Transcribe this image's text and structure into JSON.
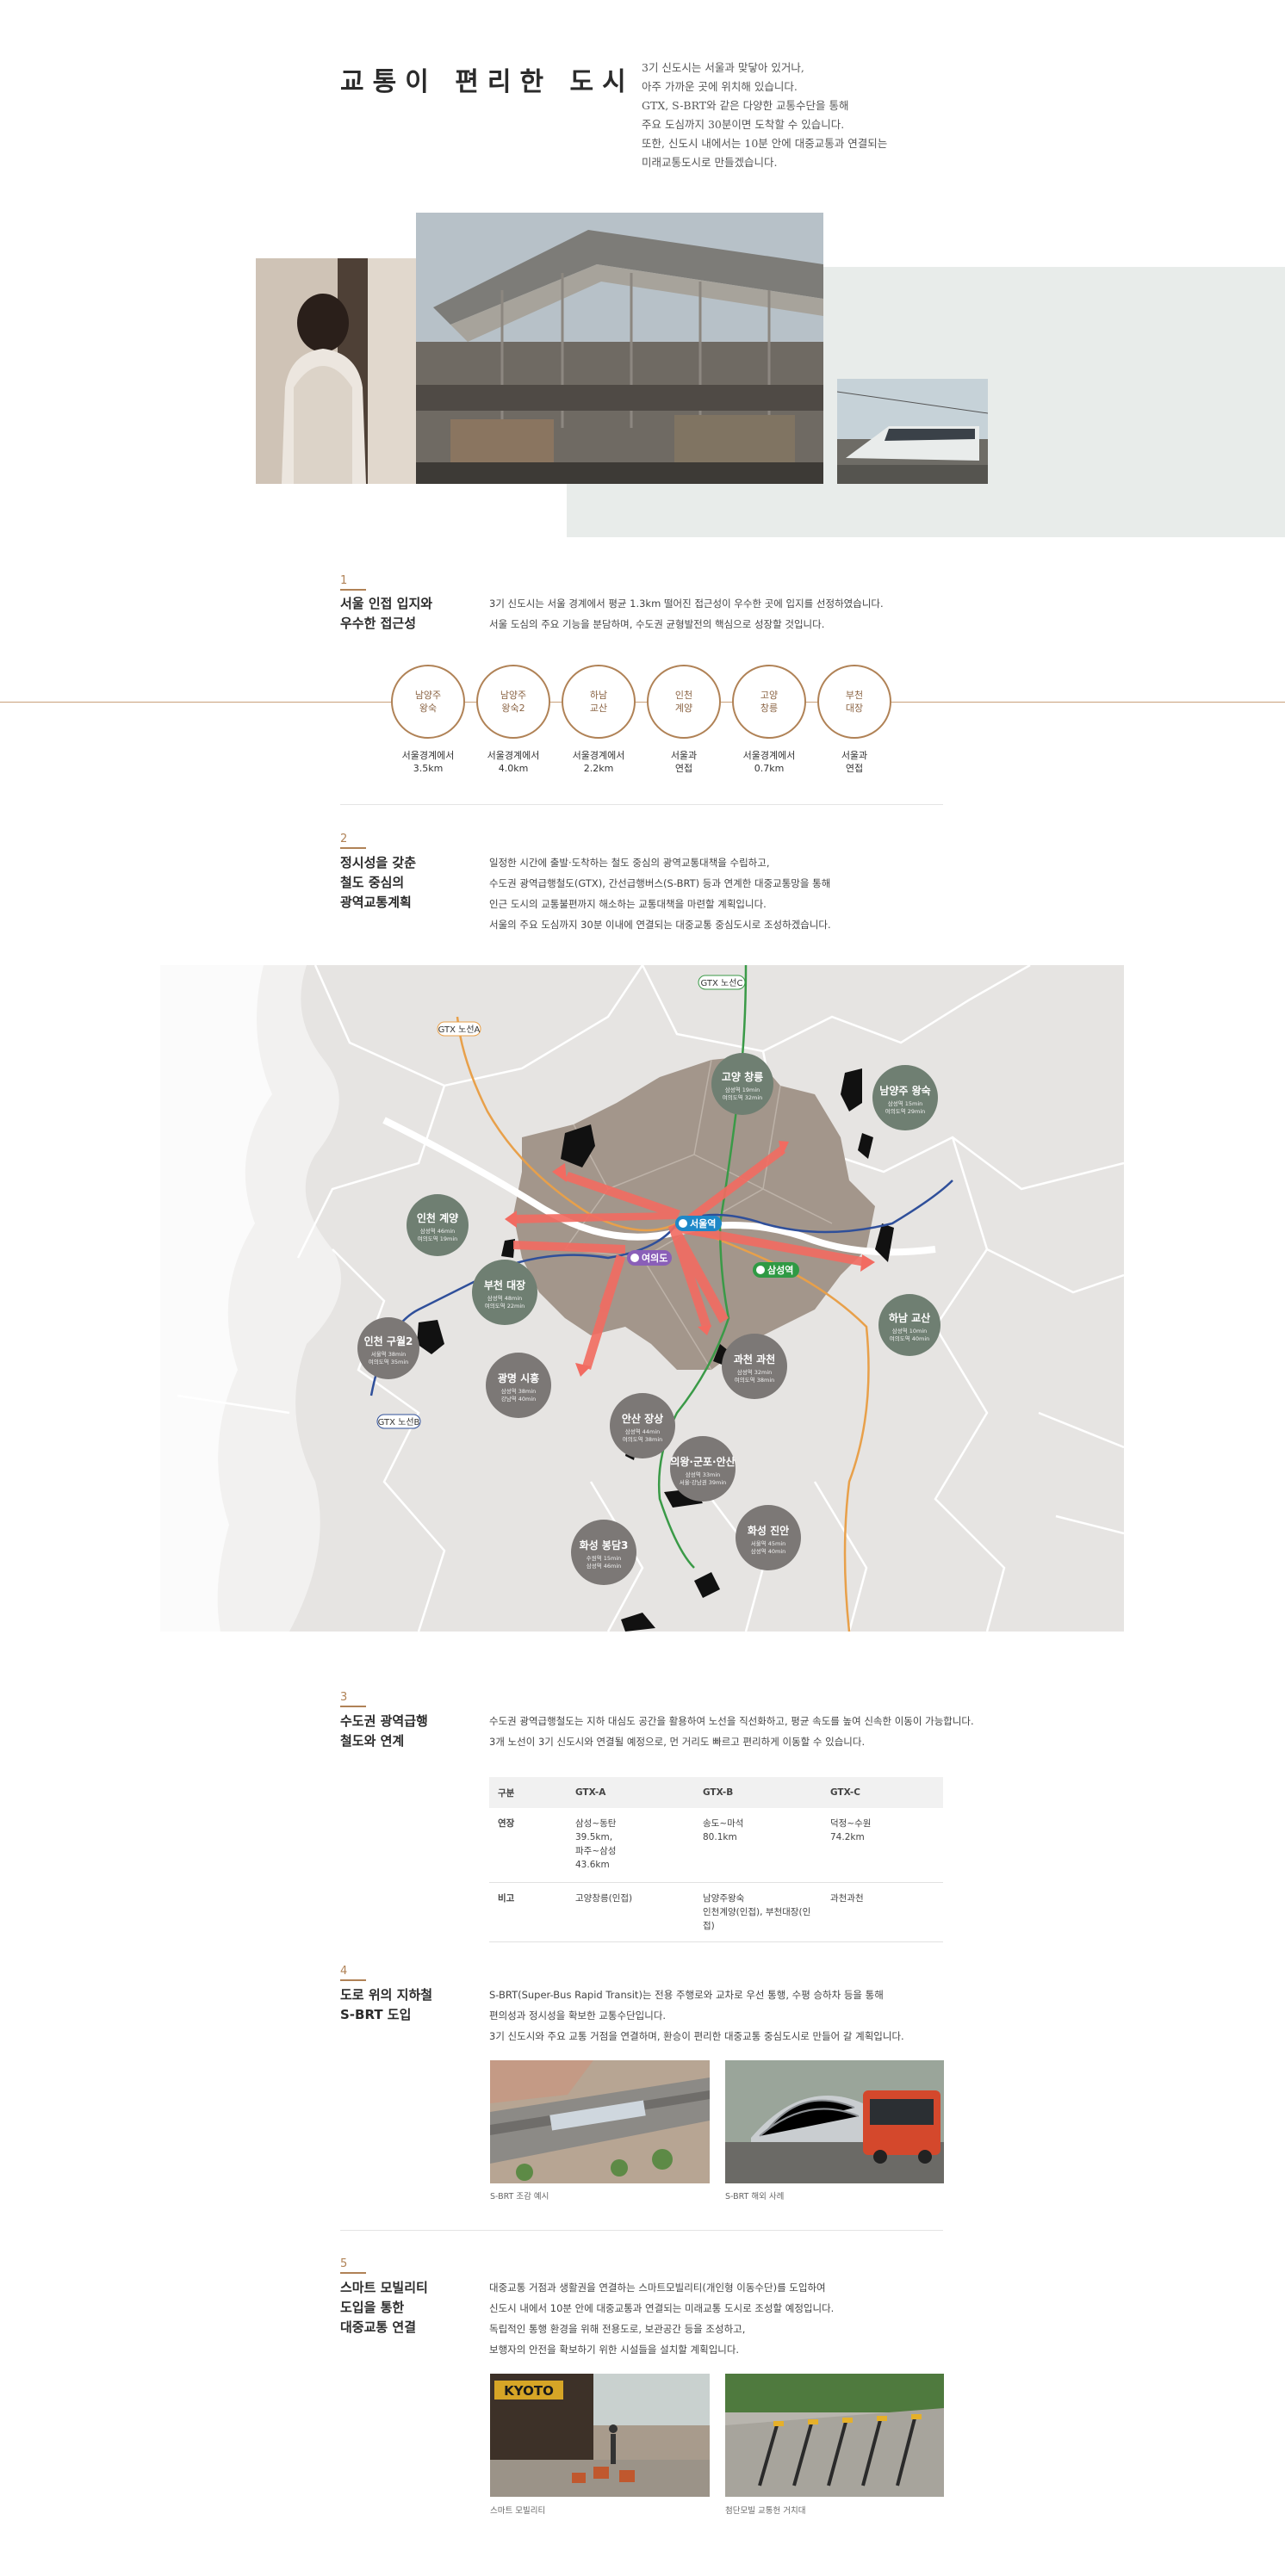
{
  "header": {
    "title": "교통이 편리한 도시",
    "desc": [
      "3기 신도시는 서울과 맞닿아 있거나,",
      "아주 가까운 곳에 위치해 있습니다.",
      "GTX, S-BRT와 같은 다양한 교통수단을 통해",
      "주요 도심까지 30분이면 도착할 수 있습니다.",
      "또한, 신도시 내에서는 10분 안에 대중교통과 연결되는",
      "미래교통도시로 만들겠습니다."
    ]
  },
  "s1": {
    "num": "1",
    "title": [
      "서울 인접 입지와",
      "우수한 접근성"
    ],
    "body": [
      "3기 신도시는 서울 경계에서 평균 1.3km 떨어진 접근성이 우수한 곳에 입지를 선정하였습니다.",
      "서울 도심의 주요 기능을 분담하며, 수도권 균형발전의 핵심으로 성장할 것입니다."
    ],
    "circles": [
      {
        "name": [
          "남양주",
          "왕숙"
        ],
        "cap": [
          "서울경계에서",
          "3.5km"
        ]
      },
      {
        "name": [
          "남양주",
          "왕숙2"
        ],
        "cap": [
          "서울경계에서",
          "4.0km"
        ]
      },
      {
        "name": [
          "하남",
          "교산"
        ],
        "cap": [
          "서울경계에서",
          "2.2km"
        ]
      },
      {
        "name": [
          "인천",
          "계양"
        ],
        "cap": [
          "서울과",
          "연접"
        ]
      },
      {
        "name": [
          "고양",
          "창릉"
        ],
        "cap": [
          "서울경계에서",
          "0.7km"
        ]
      },
      {
        "name": [
          "부천",
          "대장"
        ],
        "cap": [
          "서울과",
          "연접"
        ]
      }
    ]
  },
  "s2": {
    "num": "2",
    "title": [
      "정시성을 갖춘",
      "철도 중심의",
      "광역교통계획"
    ],
    "body": [
      "일정한 시간에 출발·도착하는 철도 중심의 광역교통대책을 수립하고,",
      "수도권 광역급행철도(GTX), 간선급행버스(S-BRT) 등과 연계한 대중교통망을 통해",
      "인근 도시의 교통불편까지 해소하는 교통대책을 마련할 계획입니다.",
      "서울의 주요 도심까지 30분 이내에 연결되는 대중교통 중심도시로 조성하겠습니다."
    ]
  },
  "map": {
    "lines": [
      {
        "label": "GTX 노선A",
        "color": "#e8a04a"
      },
      {
        "label": "GTX 노선C",
        "color": "#3a9a47"
      },
      {
        "label": "GTX 노선B",
        "color": "#2f4f9a"
      }
    ],
    "stations": [
      "서울역",
      "여의도",
      "삼성역"
    ],
    "cities": [
      {
        "name": "고양 창릉",
        "info": [
          "삼성역 19min",
          "여의도역 32min"
        ]
      },
      {
        "name": "남양주 왕숙",
        "info": [
          "삼성역 15min",
          "여의도역 29min"
        ]
      },
      {
        "name": "인천 계양",
        "info": [
          "삼성역 46min",
          "여의도역 19min"
        ]
      },
      {
        "name": "부천 대장",
        "info": [
          "삼성역 48min",
          "여의도역 22min"
        ]
      },
      {
        "name": "인천 구월2",
        "info": [
          "서울역 38min",
          "여의도역 35min"
        ]
      },
      {
        "name": "광명 시흥",
        "info": [
          "삼성역 38min",
          "강남역 40min"
        ]
      },
      {
        "name": "하남 교산",
        "info": [
          "삼성역 10min",
          "여의도역 40min"
        ]
      },
      {
        "name": "과천 과천",
        "info": [
          "삼성역 32min",
          "여의도역 38min"
        ]
      },
      {
        "name": "안산 장상",
        "info": [
          "삼성역 44min",
          "여의도역 38min"
        ]
      },
      {
        "name": "의왕·군포·안산",
        "info": [
          "삼성역 33min",
          "서울·강남권 39min"
        ]
      },
      {
        "name": "화성 진안",
        "info": [
          "서울역 45min",
          "삼성역 40min"
        ]
      },
      {
        "name": "화성 봉담3",
        "info": [
          "수원역 15min",
          "삼성역 46min"
        ]
      }
    ],
    "colors": {
      "seoul": "#a3968b",
      "badge": "#6f7f72",
      "badge_grey": "#7c7876",
      "arrow": "#f26b61",
      "land": "#e6e4e2"
    }
  },
  "s3": {
    "num": "3",
    "title": [
      "수도권 광역급행",
      "철도와 연계"
    ],
    "body": [
      "수도권 광역급행철도는 지하 대심도 공간을 활용하여 노선을 직선화하고, 평균 속도를 높여 신속한 이동이 가능합니다.",
      "3개 노선이 3기 신도시와 연결될 예정으로, 먼 거리도 빠르고 편리하게 이동할 수 있습니다."
    ],
    "table": {
      "headers": [
        "구분",
        "GTX-A",
        "GTX-B",
        "GTX-C"
      ],
      "rows": [
        {
          "label": "연장",
          "cells": [
            [
              "삼성~동탄",
              "39.5km,",
              "파주~삼성",
              "43.6km"
            ],
            [
              "송도~마석",
              "80.1km"
            ],
            [
              "덕정~수원",
              "74.2km"
            ]
          ]
        },
        {
          "label": "비고",
          "cells": [
            [
              "고양창릉(인접)"
            ],
            [
              "남양주왕숙",
              "인천계양(인접), 부천대장(인접)"
            ],
            [
              "과천과천"
            ]
          ]
        }
      ]
    }
  },
  "s4": {
    "num": "4",
    "title": [
      "도로 위의 지하철",
      "S-BRT 도입"
    ],
    "body": [
      "S-BRT(Super-Bus Rapid Transit)는 전용 주행로와 교차로 우선 통행, 수평 승하차 등을 통해",
      "편의성과 정시성을 확보한 교통수단입니다.",
      "3기 신도시와 주요 교통 거점을 연결하며, 환승이 편리한 대중교통 중심도시로 만들어 갈 계획입니다."
    ],
    "captions": [
      "S-BRT 조감 예시",
      "S-BRT 해외 사례"
    ]
  },
  "s5": {
    "num": "5",
    "title": [
      "스마트 모빌리티",
      "도입을 통한",
      "대중교통 연결"
    ],
    "body": [
      "대중교통 거점과 생활권을 연결하는 스마트모빌리티(개인형 이동수단)를 도입하여",
      "신도시 내에서 10분 안에 대중교통과 연결되는 미래교통 도시로 조성할 예정입니다.",
      "독립적인 통행 환경을 위해 전용도로, 보관공간 등을 조성하고,",
      "보행자의 안전을 확보하기 위한 시설들을 설치할 계획입니다."
    ],
    "photo_sign": "KYOTO",
    "captions": [
      "스마트 모빌리티",
      "첨단모빌 교통헌 거치대"
    ]
  }
}
